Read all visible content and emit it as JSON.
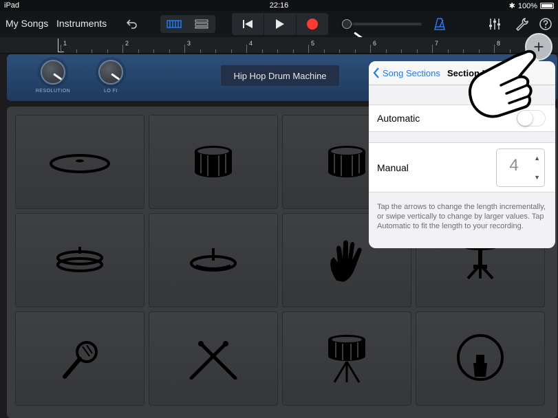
{
  "status_bar": {
    "device": "iPad",
    "time": "22:16",
    "battery": "100%"
  },
  "toolbar": {
    "my_songs": "My Songs",
    "instruments": "Instruments"
  },
  "ruler": {
    "bars": [
      "1",
      "2",
      "3",
      "4",
      "5",
      "6",
      "7",
      "8"
    ]
  },
  "instrument": {
    "knobs": [
      {
        "label": "RESOLUTION"
      },
      {
        "label": "LO FI"
      }
    ],
    "kit_name": "Hip Hop Drum Machine"
  },
  "popover": {
    "back_label": "Song Sections",
    "title": "Section Length",
    "automatic_label": "Automatic",
    "automatic_on": false,
    "manual_label": "Manual",
    "manual_value": "4",
    "help_text": "Tap the arrows to change the length incrementally, or swipe vertically to change by larger values. Tap Automatic to fit the length to your recording."
  },
  "pads": [
    {
      "icon": "cymbal-icon"
    },
    {
      "icon": "snare-drum-icon"
    },
    {
      "icon": "snare-drum-icon"
    },
    {
      "icon": "hidden"
    },
    {
      "icon": "hi-hat-closed-icon"
    },
    {
      "icon": "hi-hat-open-icon"
    },
    {
      "icon": "hand-clap-icon"
    },
    {
      "icon": "hi-hat-stand-icon"
    },
    {
      "icon": "maraca-icon"
    },
    {
      "icon": "drumsticks-icon"
    },
    {
      "icon": "snare-on-stand-icon"
    },
    {
      "icon": "kick-drum-icon"
    }
  ],
  "colors": {
    "accent": "#1f7bf5",
    "record": "#ff3b30",
    "header": "#2c4f7a"
  }
}
